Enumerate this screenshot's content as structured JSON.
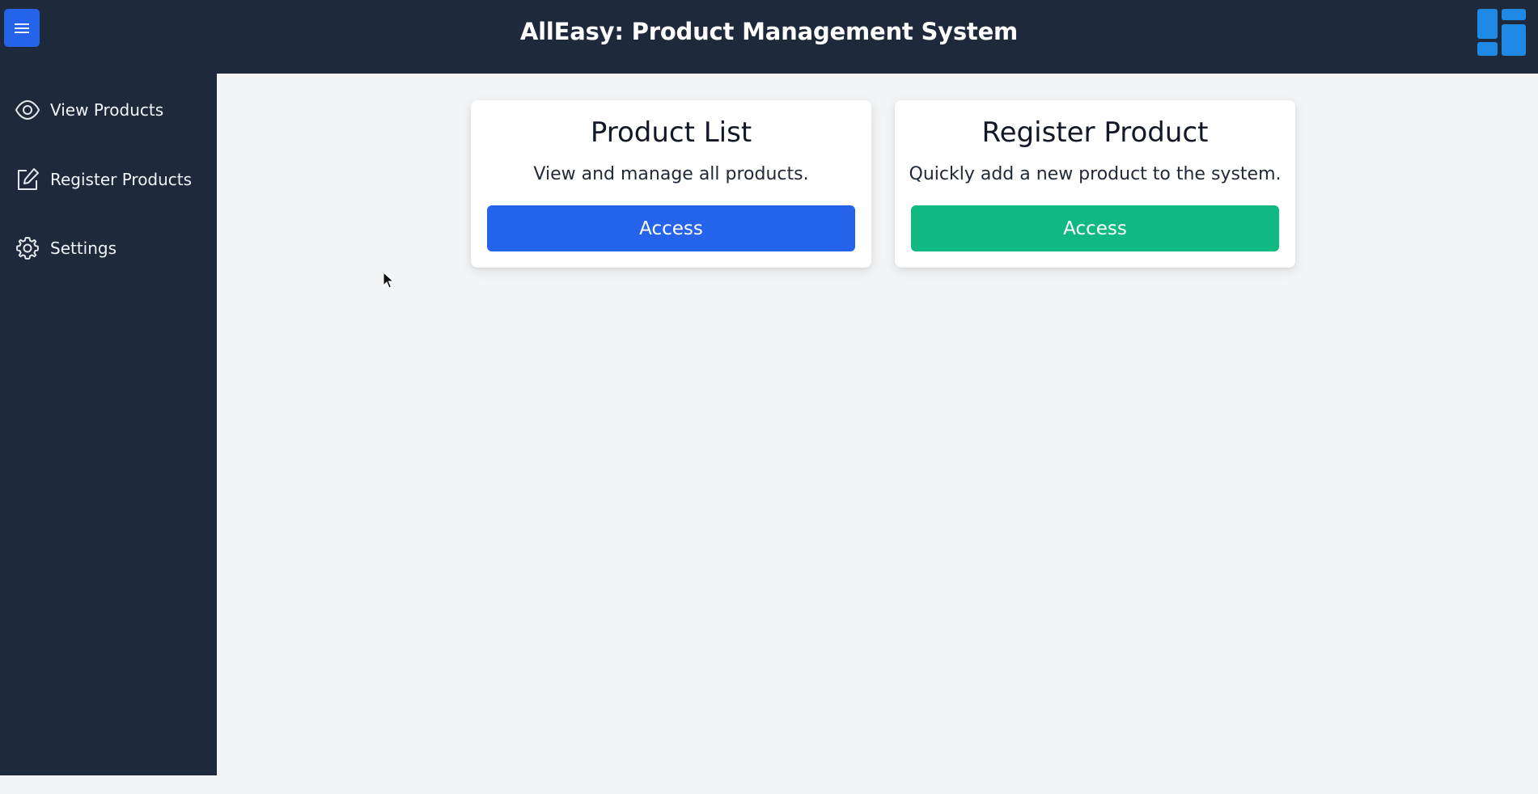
{
  "header": {
    "title": "AllEasy: Product Management System",
    "menu_icon": "hamburger-icon",
    "logo_icon": "dashboard-grid-icon",
    "accent_color": "#2563eb",
    "logo_color": "#1e88e5",
    "background_color": "#1e293b"
  },
  "sidebar": {
    "items": [
      {
        "label": "View Products",
        "icon": "eye-icon"
      },
      {
        "label": "Register Products",
        "icon": "edit-icon"
      },
      {
        "label": "Settings",
        "icon": "gear-icon"
      }
    ]
  },
  "main": {
    "cards": [
      {
        "title": "Product List",
        "description": "View and manage all products.",
        "button_label": "Access",
        "button_color": "#2563eb"
      },
      {
        "title": "Register Product",
        "description": "Quickly add a new product to the system.",
        "button_label": "Access",
        "button_color": "#10b981"
      }
    ]
  }
}
